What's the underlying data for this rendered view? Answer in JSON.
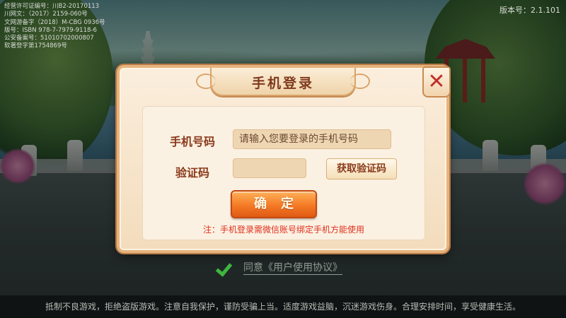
{
  "license_lines": [
    "经营许可证编号：川B2-20170113",
    "川网文：（2017）2159-060号",
    "文网游备字（2018）M-CBG 0936号",
    "版号：ISBN 978-7-7979-9118-6",
    "公安备案号：51010702000807",
    "软著登字第1754869号"
  ],
  "version": "版本号：2.1.101",
  "dialog": {
    "title": "手机登录",
    "close_icon": "close-x-icon",
    "phone_label": "手机号码",
    "phone_placeholder": "请输入您要登录的手机号码",
    "phone_value": "",
    "code_label": "验证码",
    "code_value": "",
    "get_code_label": "获取验证码",
    "confirm_label": "确定",
    "note": "注：手机登录需微信账号绑定手机方能使用"
  },
  "agreement": {
    "checked": true,
    "check_icon": "checkmark-icon",
    "text": "同意《用户使用协议》"
  },
  "footer": "抵制不良游戏，拒绝盗版游戏。注意自我保护，谨防受骗上当。适度游戏益脑，沉迷游戏伤身。合理安排时间，享受健康生活。",
  "colors": {
    "accent": "#e06a1a",
    "title_text": "#7f3a1e",
    "note_text": "#e0301e",
    "check_green": "#3fb63f"
  }
}
